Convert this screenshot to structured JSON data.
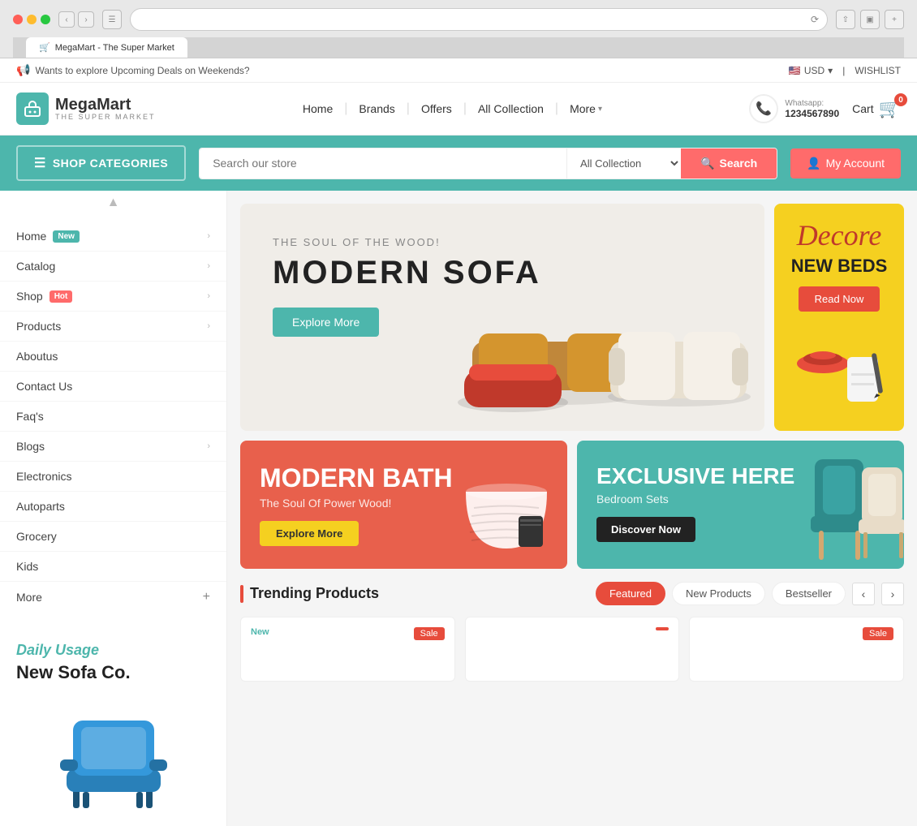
{
  "browser": {
    "dots": [
      "red",
      "yellow",
      "green"
    ],
    "tab_label": "MegaMart - The Super Market"
  },
  "announcement": {
    "text": "Wants to explore Upcoming Deals on Weekends?",
    "currency": "USD",
    "wishlist": "WISHLIST"
  },
  "header": {
    "logo_name": "MegaMart",
    "logo_sub": "THE SUPER MARKET",
    "nav_items": [
      "Home",
      "Brands",
      "Offers",
      "All Collection",
      "More"
    ],
    "whatsapp_label": "Whatsapp:",
    "whatsapp_number": "1234567890",
    "cart_label": "Cart",
    "cart_count": "0"
  },
  "search_bar": {
    "categories_btn": "SHOP CATEGORIES",
    "search_placeholder": "Search our store",
    "category_option": "All Collection",
    "search_btn": "Search",
    "account_btn": "My Account"
  },
  "sidebar": {
    "nav_items": [
      {
        "label": "Home",
        "badge": "New",
        "badge_type": "new",
        "has_chevron": true
      },
      {
        "label": "Catalog",
        "badge": null,
        "badge_type": null,
        "has_chevron": true
      },
      {
        "label": "Shop",
        "badge": "Hot",
        "badge_type": "hot",
        "has_chevron": true
      },
      {
        "label": "Products",
        "badge": null,
        "badge_type": null,
        "has_chevron": true
      },
      {
        "label": "Aboutus",
        "badge": null,
        "badge_type": null,
        "has_chevron": false
      },
      {
        "label": "Contact Us",
        "badge": null,
        "badge_type": null,
        "has_chevron": false
      },
      {
        "label": "Faq's",
        "badge": null,
        "badge_type": null,
        "has_chevron": false
      },
      {
        "label": "Blogs",
        "badge": null,
        "badge_type": null,
        "has_chevron": true
      },
      {
        "label": "Electronics",
        "badge": null,
        "badge_type": null,
        "has_chevron": false
      },
      {
        "label": "Autoparts",
        "badge": null,
        "badge_type": null,
        "has_chevron": false
      },
      {
        "label": "Grocery",
        "badge": null,
        "badge_type": null,
        "has_chevron": false
      },
      {
        "label": "Kids",
        "badge": null,
        "badge_type": null,
        "has_chevron": false
      }
    ],
    "more_label": "More",
    "promo_daily": "Daily Usage",
    "promo_title": "New Sofa Co."
  },
  "hero": {
    "main_subtitle": "THE SOUL OF THE WOOD!",
    "main_title": "MODERN SOFA",
    "explore_btn": "Explore More",
    "side_title": "Decore",
    "side_subtitle": "NEW BEDS",
    "read_now_btn": "Read Now"
  },
  "promo_banners": {
    "bath_title": "MODERN BATH",
    "bath_subtitle": "The Soul Of Power Wood!",
    "bath_btn": "Explore More",
    "exclusive_title": "EXCLUSIVE HERE",
    "exclusive_subtitle": "Bedroom Sets",
    "discover_btn": "Discover Now"
  },
  "trending": {
    "title": "Trending Products",
    "tabs": [
      "Featured",
      "New Products",
      "Bestseller"
    ],
    "active_tab": "Featured",
    "products": [
      {
        "tag_new": "New",
        "tag_sale": "Sale"
      },
      {
        "tag_new": "",
        "tag_sale": ""
      },
      {
        "tag_new": "",
        "tag_sale": "Sale"
      }
    ]
  }
}
